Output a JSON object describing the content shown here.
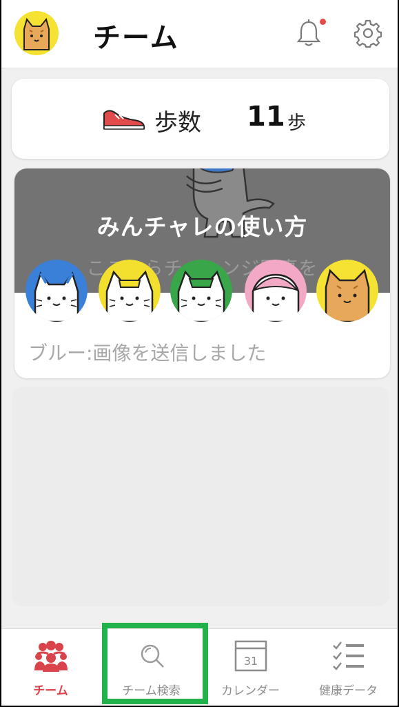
{
  "header": {
    "title": "チーム",
    "avatar_icon": "cat-avatar-icon",
    "notification_icon": "bell-icon",
    "settings_icon": "gear-icon",
    "notification_dot_color": "#e84a4a"
  },
  "steps": {
    "label": "歩数",
    "value": "11",
    "unit": "歩",
    "icon": "sneaker-icon"
  },
  "team_card": {
    "banner_title": "みんチャレの使い方",
    "banner_subtitle": "ここからチャレンジ写真を",
    "members": [
      {
        "name": "blue-cat",
        "color": "#3a7fd8"
      },
      {
        "name": "yellow-cat",
        "color": "#f2df2e"
      },
      {
        "name": "green-cat",
        "color": "#39a64a"
      },
      {
        "name": "pink-cat",
        "color": "#f3a9c6"
      },
      {
        "name": "orange-cat",
        "color": "#f6e233"
      }
    ],
    "last_message": "ブルー:画像を送信しました"
  },
  "tabbar": {
    "accent_color": "#d9434a",
    "highlight_color": "#22b24c",
    "tabs": [
      {
        "label": "チーム",
        "icon": "team-icon",
        "active": true
      },
      {
        "label": "チーム検索",
        "icon": "search-icon",
        "active": false
      },
      {
        "label": "カレンダー",
        "icon": "calendar-icon",
        "active": false
      },
      {
        "label": "健康データ",
        "icon": "checklist-icon",
        "active": false
      }
    ],
    "calendar_day": "31"
  }
}
